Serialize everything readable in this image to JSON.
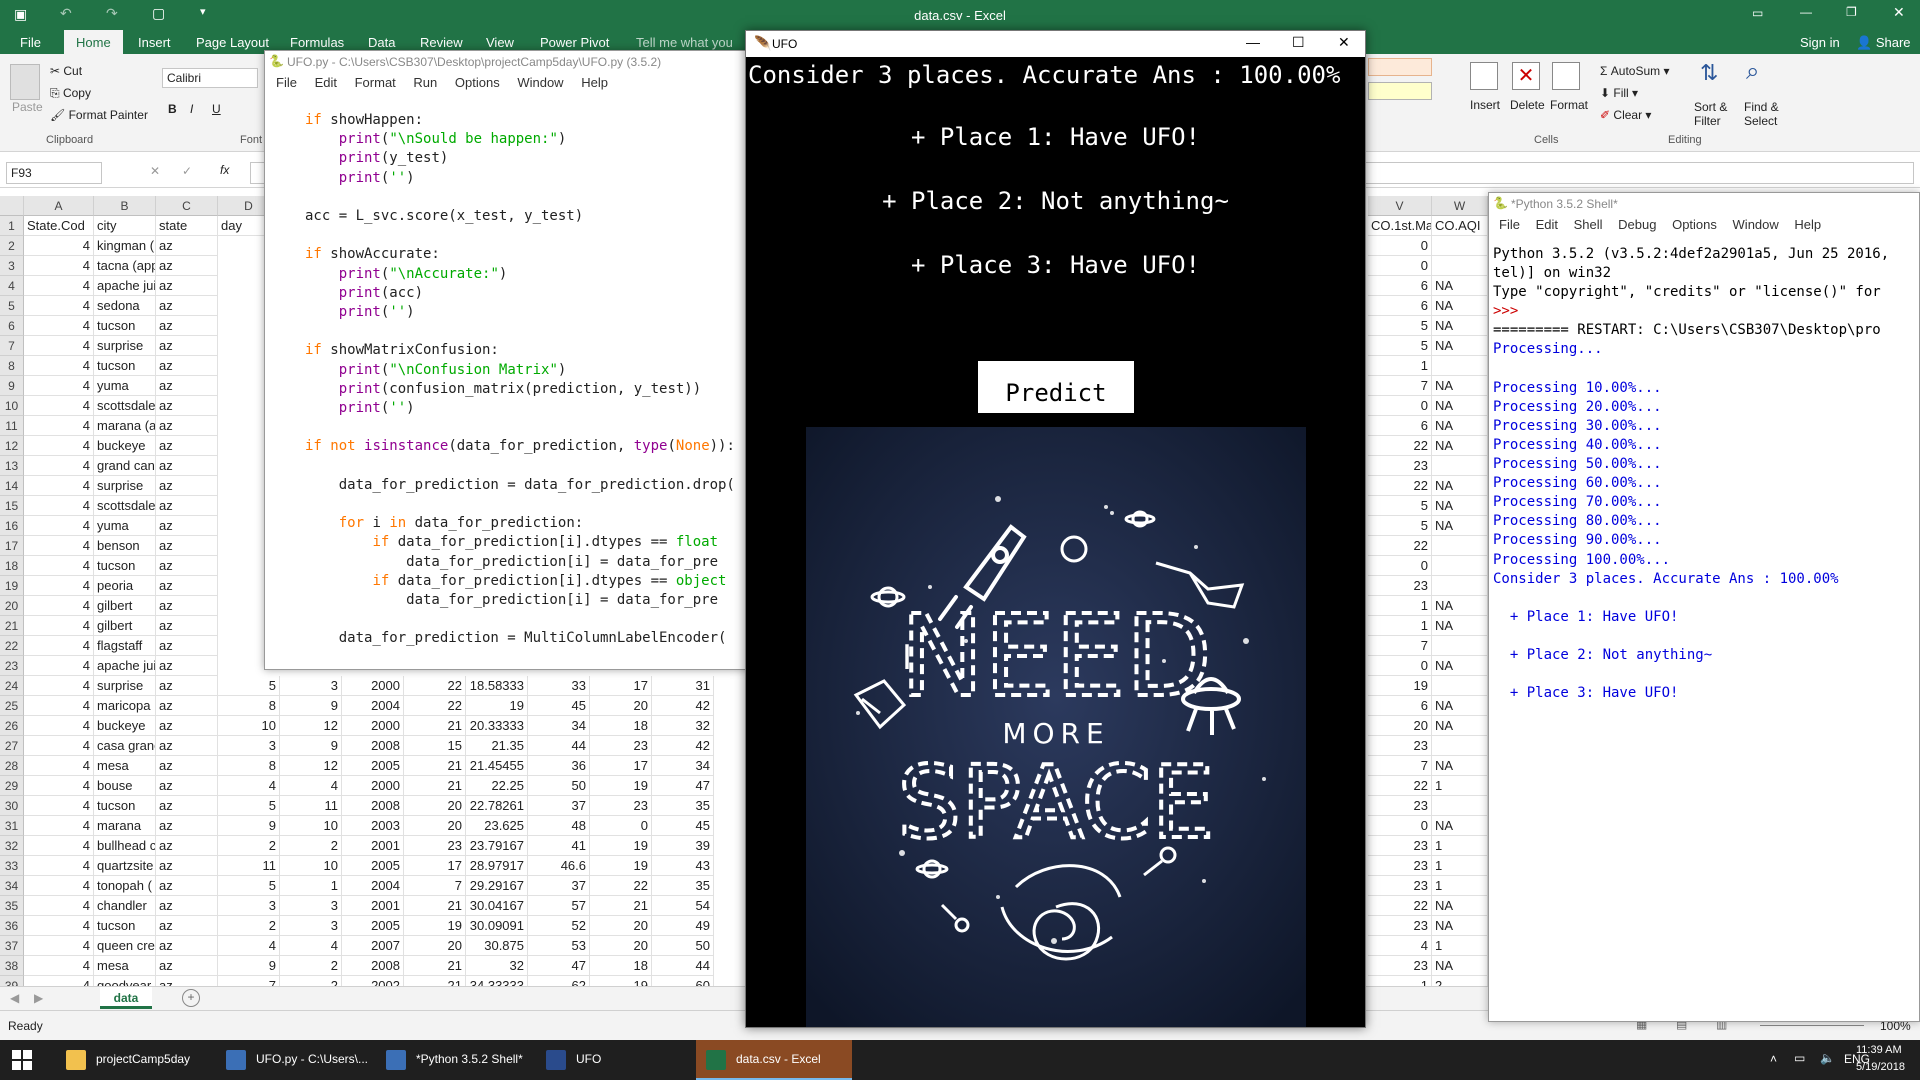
{
  "excel": {
    "title": "data.csv - Excel",
    "tabs": [
      "File",
      "Home",
      "Insert",
      "Page Layout",
      "Formulas",
      "Data",
      "Review",
      "View",
      "Power Pivot",
      "Tell me what you"
    ],
    "active_tab": "Home",
    "signin": "Sign in",
    "share": "Share",
    "clipboard": {
      "paste": "Paste",
      "cut": "Cut",
      "copy": "Copy",
      "format_painter": "Format Painter",
      "group": "Clipboard"
    },
    "font": {
      "name": "Calibri",
      "group": "Font"
    },
    "cells_group": {
      "insert": "Insert",
      "delete": "Delete",
      "format": "Format",
      "group": "Cells"
    },
    "editing_group": {
      "autosum": "AutoSum",
      "fill": "Fill",
      "clear": "Clear",
      "sort": "Sort &",
      "filter": "Filter",
      "find": "Find &",
      "select": "Select",
      "group": "Editing"
    },
    "name_box": "F93",
    "fx": "fx",
    "columns": [
      "A",
      "B",
      "C",
      "D"
    ],
    "right_columns": [
      "V",
      "W"
    ],
    "right_headers": [
      "CO.1st.Ma",
      "CO.AQI"
    ],
    "headers": [
      "State.Cod",
      "city",
      "state",
      "day"
    ],
    "rows": [
      {
        "n": "2",
        "a": "4",
        "city": "kingman (",
        "st": "az",
        "v": "0",
        "w": ""
      },
      {
        "n": "3",
        "a": "4",
        "city": "tacna (app",
        "st": "az",
        "v": "0",
        "w": ""
      },
      {
        "n": "4",
        "a": "4",
        "city": "apache jui",
        "st": "az",
        "v": "6",
        "w": "NA"
      },
      {
        "n": "5",
        "a": "4",
        "city": "sedona",
        "st": "az",
        "v": "6",
        "w": "NA"
      },
      {
        "n": "6",
        "a": "4",
        "city": "tucson",
        "st": "az",
        "v": "5",
        "w": "NA"
      },
      {
        "n": "7",
        "a": "4",
        "city": "surprise",
        "st": "az",
        "v": "5",
        "w": "NA"
      },
      {
        "n": "8",
        "a": "4",
        "city": "tucson",
        "st": "az",
        "v": "1",
        "w": ""
      },
      {
        "n": "9",
        "a": "4",
        "city": "yuma",
        "st": "az",
        "v": "7",
        "w": "NA"
      },
      {
        "n": "10",
        "a": "4",
        "city": "scottsdale",
        "st": "az",
        "v": "0",
        "w": "NA"
      },
      {
        "n": "11",
        "a": "4",
        "city": "marana (a",
        "st": "az",
        "v": "6",
        "w": "NA"
      },
      {
        "n": "12",
        "a": "4",
        "city": "buckeye",
        "st": "az",
        "v": "22",
        "w": "NA"
      },
      {
        "n": "13",
        "a": "4",
        "city": "grand can",
        "st": "az",
        "v": "23",
        "w": ""
      },
      {
        "n": "14",
        "a": "4",
        "city": "surprise",
        "st": "az",
        "v": "22",
        "w": "NA"
      },
      {
        "n": "15",
        "a": "4",
        "city": "scottsdale",
        "st": "az",
        "v": "5",
        "w": "NA"
      },
      {
        "n": "16",
        "a": "4",
        "city": "yuma",
        "st": "az",
        "v": "5",
        "w": "NA"
      },
      {
        "n": "17",
        "a": "4",
        "city": "benson",
        "st": "az",
        "v": "22",
        "w": ""
      },
      {
        "n": "18",
        "a": "4",
        "city": "tucson",
        "st": "az",
        "v": "0",
        "w": ""
      },
      {
        "n": "19",
        "a": "4",
        "city": "peoria",
        "st": "az",
        "v": "23",
        "w": ""
      },
      {
        "n": "20",
        "a": "4",
        "city": "gilbert",
        "st": "az",
        "v": "1",
        "w": "NA"
      },
      {
        "n": "21",
        "a": "4",
        "city": "gilbert",
        "st": "az",
        "v": "1",
        "w": "NA"
      },
      {
        "n": "22",
        "a": "4",
        "city": "flagstaff",
        "st": "az",
        "v": "7",
        "w": ""
      },
      {
        "n": "23",
        "a": "4",
        "city": "apache jui",
        "st": "az",
        "v": "0",
        "w": "NA"
      },
      {
        "n": "24",
        "a": "4",
        "city": "surprise",
        "st": "az",
        "d": "5",
        "e": "3",
        "f": "2000",
        "g": "22",
        "h": "18.58333",
        "i": "33",
        "j": "17",
        "k": "31",
        "v": "19",
        "w": ""
      },
      {
        "n": "25",
        "a": "4",
        "city": "maricopa",
        "st": "az",
        "d": "8",
        "e": "9",
        "f": "2004",
        "g": "22",
        "h": "19",
        "i": "45",
        "j": "20",
        "k": "42",
        "v": "6",
        "w": "NA"
      },
      {
        "n": "26",
        "a": "4",
        "city": "buckeye",
        "st": "az",
        "d": "10",
        "e": "12",
        "f": "2000",
        "g": "21",
        "h": "20.33333",
        "i": "34",
        "j": "18",
        "k": "32",
        "v": "20",
        "w": "NA"
      },
      {
        "n": "27",
        "a": "4",
        "city": "casa granc",
        "st": "az",
        "d": "3",
        "e": "9",
        "f": "2008",
        "g": "15",
        "h": "21.35",
        "i": "44",
        "j": "23",
        "k": "42",
        "v": "23",
        "w": ""
      },
      {
        "n": "28",
        "a": "4",
        "city": "mesa",
        "st": "az",
        "d": "8",
        "e": "12",
        "f": "2005",
        "g": "21",
        "h": "21.45455",
        "i": "36",
        "j": "17",
        "k": "34",
        "v": "7",
        "w": "NA"
      },
      {
        "n": "29",
        "a": "4",
        "city": "bouse",
        "st": "az",
        "d": "4",
        "e": "4",
        "f": "2000",
        "g": "21",
        "h": "22.25",
        "i": "50",
        "j": "19",
        "k": "47",
        "v": "22",
        "w": "1"
      },
      {
        "n": "30",
        "a": "4",
        "city": "tucson",
        "st": "az",
        "d": "5",
        "e": "11",
        "f": "2008",
        "g": "20",
        "h": "22.78261",
        "i": "37",
        "j": "23",
        "k": "35",
        "v": "23",
        "w": ""
      },
      {
        "n": "31",
        "a": "4",
        "city": "marana",
        "st": "az",
        "d": "9",
        "e": "10",
        "f": "2003",
        "g": "20",
        "h": "23.625",
        "i": "48",
        "j": "0",
        "k": "45",
        "v": "0",
        "w": "NA"
      },
      {
        "n": "32",
        "a": "4",
        "city": "bullhead c",
        "st": "az",
        "d": "2",
        "e": "2",
        "f": "2001",
        "g": "23",
        "h": "23.79167",
        "i": "41",
        "j": "19",
        "k": "39",
        "v": "23",
        "w": "1"
      },
      {
        "n": "33",
        "a": "4",
        "city": "quartzsite",
        "st": "az",
        "d": "11",
        "e": "10",
        "f": "2005",
        "g": "17",
        "h": "28.97917",
        "i": "46.6",
        "j": "19",
        "k": "43",
        "v": "23",
        "w": "1"
      },
      {
        "n": "34",
        "a": "4",
        "city": "tonopah (",
        "st": "az",
        "d": "5",
        "e": "1",
        "f": "2004",
        "g": "7",
        "h": "29.29167",
        "i": "37",
        "j": "22",
        "k": "35",
        "v": "23",
        "w": "1"
      },
      {
        "n": "35",
        "a": "4",
        "city": "chandler",
        "st": "az",
        "d": "3",
        "e": "3",
        "f": "2001",
        "g": "21",
        "h": "30.04167",
        "i": "57",
        "j": "21",
        "k": "54",
        "v": "22",
        "w": "NA"
      },
      {
        "n": "36",
        "a": "4",
        "city": "tucson",
        "st": "az",
        "d": "2",
        "e": "3",
        "f": "2005",
        "g": "19",
        "h": "30.09091",
        "i": "52",
        "j": "20",
        "k": "49",
        "v": "23",
        "w": "NA"
      },
      {
        "n": "37",
        "a": "4",
        "city": "queen cre",
        "st": "az",
        "d": "4",
        "e": "4",
        "f": "2007",
        "g": "20",
        "h": "30.875",
        "i": "53",
        "j": "20",
        "k": "50",
        "v": "4",
        "w": "1"
      },
      {
        "n": "38",
        "a": "4",
        "city": "mesa",
        "st": "az",
        "d": "9",
        "e": "2",
        "f": "2008",
        "g": "21",
        "h": "32",
        "i": "47",
        "j": "18",
        "k": "44",
        "v": "23",
        "w": "NA"
      },
      {
        "n": "39",
        "a": "4",
        "city": "goodyear",
        "st": "az",
        "d": "7",
        "e": "2",
        "f": "2002",
        "g": "21",
        "h": "34.33333",
        "i": "62",
        "j": "19",
        "k": "60",
        "v": "1",
        "w": "2"
      }
    ],
    "sheet_tab": "data",
    "status": "Ready",
    "zoom": "100%"
  },
  "editor": {
    "title": "UFO.py - C:\\Users\\CSB307\\Desktop\\projectCamp5day\\UFO.py (3.5.2)",
    "menu": [
      "File",
      "Edit",
      "Format",
      "Run",
      "Options",
      "Window",
      "Help"
    ]
  },
  "shell": {
    "title": "*Python 3.5.2 Shell*",
    "menu": [
      "File",
      "Edit",
      "Shell",
      "Debug",
      "Options",
      "Window",
      "Help"
    ]
  },
  "ufo": {
    "title": "UFO",
    "headline": "Consider 3 places. Accurate Ans : 100.00%",
    "places": [
      "+ Place 1: Have UFO!",
      "+ Place 2: Not anything~",
      "+ Place 3: Have UFO!"
    ],
    "predict": "Predict",
    "poster": {
      "w1": "NEED",
      "w2": "MORE",
      "w3": "SPACE",
      "w0": "I"
    }
  },
  "taskbar": {
    "items": [
      "projectCamp5day",
      "UFO.py - C:\\Users\\...",
      "*Python 3.5.2 Shell*",
      "UFO",
      "data.csv - Excel"
    ],
    "lang": "ENG",
    "time": "11:39 AM",
    "date": "5/19/2018"
  },
  "colors": {
    "excel_green": "#217346",
    "keyword": "#ff7700",
    "builtin": "#900090",
    "string": "#00aa00",
    "shell_output": "#0000dd"
  }
}
